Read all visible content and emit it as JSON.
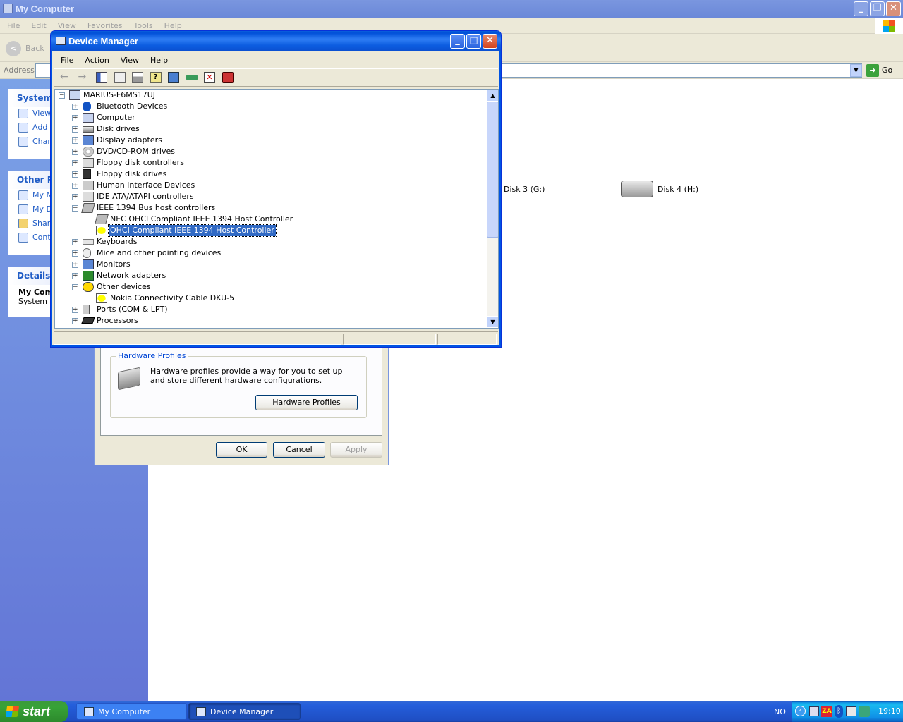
{
  "explorer": {
    "title": "My Computer",
    "menu": [
      "File",
      "Edit",
      "View",
      "Favorites",
      "Tools",
      "Help"
    ],
    "back_label": "Back",
    "address_label": "Address",
    "go_label": "Go",
    "panels": {
      "system": {
        "title": "System",
        "links": [
          "View",
          "Add",
          "Char"
        ]
      },
      "other": {
        "title": "Other Pl",
        "links": [
          "My N",
          "My D",
          "Shar",
          "Cont"
        ]
      },
      "details": {
        "title": "Details",
        "name": "My Com",
        "sub": "System F"
      }
    },
    "drives": [
      {
        "label": "Disk 3 (G:)"
      },
      {
        "label": "Disk 4 (H:)"
      }
    ]
  },
  "sysprops": {
    "group_title": "Hardware Profiles",
    "group_text": "Hardware profiles provide a way for you to set up and store different hardware configurations.",
    "profiles_button": "Hardware Profiles",
    "ok": "OK",
    "cancel": "Cancel",
    "apply": "Apply"
  },
  "devmgr": {
    "title": "Device Manager",
    "menu": [
      "File",
      "Action",
      "View",
      "Help"
    ],
    "tree": {
      "root": "MARIUS-F6MS17UJ",
      "items": [
        {
          "label": "Bluetooth Devices",
          "level": 1,
          "exp": "+",
          "icon": "bluetooth-icon"
        },
        {
          "label": "Computer",
          "level": 1,
          "exp": "+",
          "icon": "computer-icon"
        },
        {
          "label": "Disk drives",
          "level": 1,
          "exp": "+",
          "icon": "disk-drive-icon"
        },
        {
          "label": "Display adapters",
          "level": 1,
          "exp": "+",
          "icon": "display-adapter-icon"
        },
        {
          "label": "DVD/CD-ROM drives",
          "level": 1,
          "exp": "+",
          "icon": "cdrom-icon"
        },
        {
          "label": "Floppy disk controllers",
          "level": 1,
          "exp": "+",
          "icon": "floppy-controller-icon"
        },
        {
          "label": "Floppy disk drives",
          "level": 1,
          "exp": "+",
          "icon": "floppy-drive-icon"
        },
        {
          "label": "Human Interface Devices",
          "level": 1,
          "exp": "+",
          "icon": "hid-icon"
        },
        {
          "label": "IDE ATA/ATAPI controllers",
          "level": 1,
          "exp": "+",
          "icon": "ide-controller-icon"
        },
        {
          "label": "IEEE 1394 Bus host controllers",
          "level": 1,
          "exp": "-",
          "icon": "ieee1394-icon"
        },
        {
          "label": "NEC OHCI Compliant IEEE 1394 Host Controller",
          "level": 2,
          "exp": "",
          "icon": "ieee1394-device-icon"
        },
        {
          "label": "OHCI Compliant IEEE 1394 Host Controller",
          "level": 2,
          "exp": "",
          "icon": "warning-device-icon",
          "selected": true
        },
        {
          "label": "Keyboards",
          "level": 1,
          "exp": "+",
          "icon": "keyboard-icon"
        },
        {
          "label": "Mice and other pointing devices",
          "level": 1,
          "exp": "+",
          "icon": "mouse-icon"
        },
        {
          "label": "Monitors",
          "level": 1,
          "exp": "+",
          "icon": "monitor-icon"
        },
        {
          "label": "Network adapters",
          "level": 1,
          "exp": "+",
          "icon": "network-adapter-icon"
        },
        {
          "label": "Other devices",
          "level": 1,
          "exp": "-",
          "icon": "unknown-device-icon"
        },
        {
          "label": "Nokia Connectivity Cable DKU-5",
          "level": 2,
          "exp": "",
          "icon": "warning-device-icon"
        },
        {
          "label": "Ports (COM & LPT)",
          "level": 1,
          "exp": "+",
          "icon": "port-icon"
        },
        {
          "label": "Processors",
          "level": 1,
          "exp": "+",
          "icon": "processor-icon"
        }
      ]
    }
  },
  "taskbar": {
    "start": "start",
    "tasks": [
      "My Computer",
      "Device Manager"
    ],
    "lang": "NO",
    "clock": "19:10"
  }
}
